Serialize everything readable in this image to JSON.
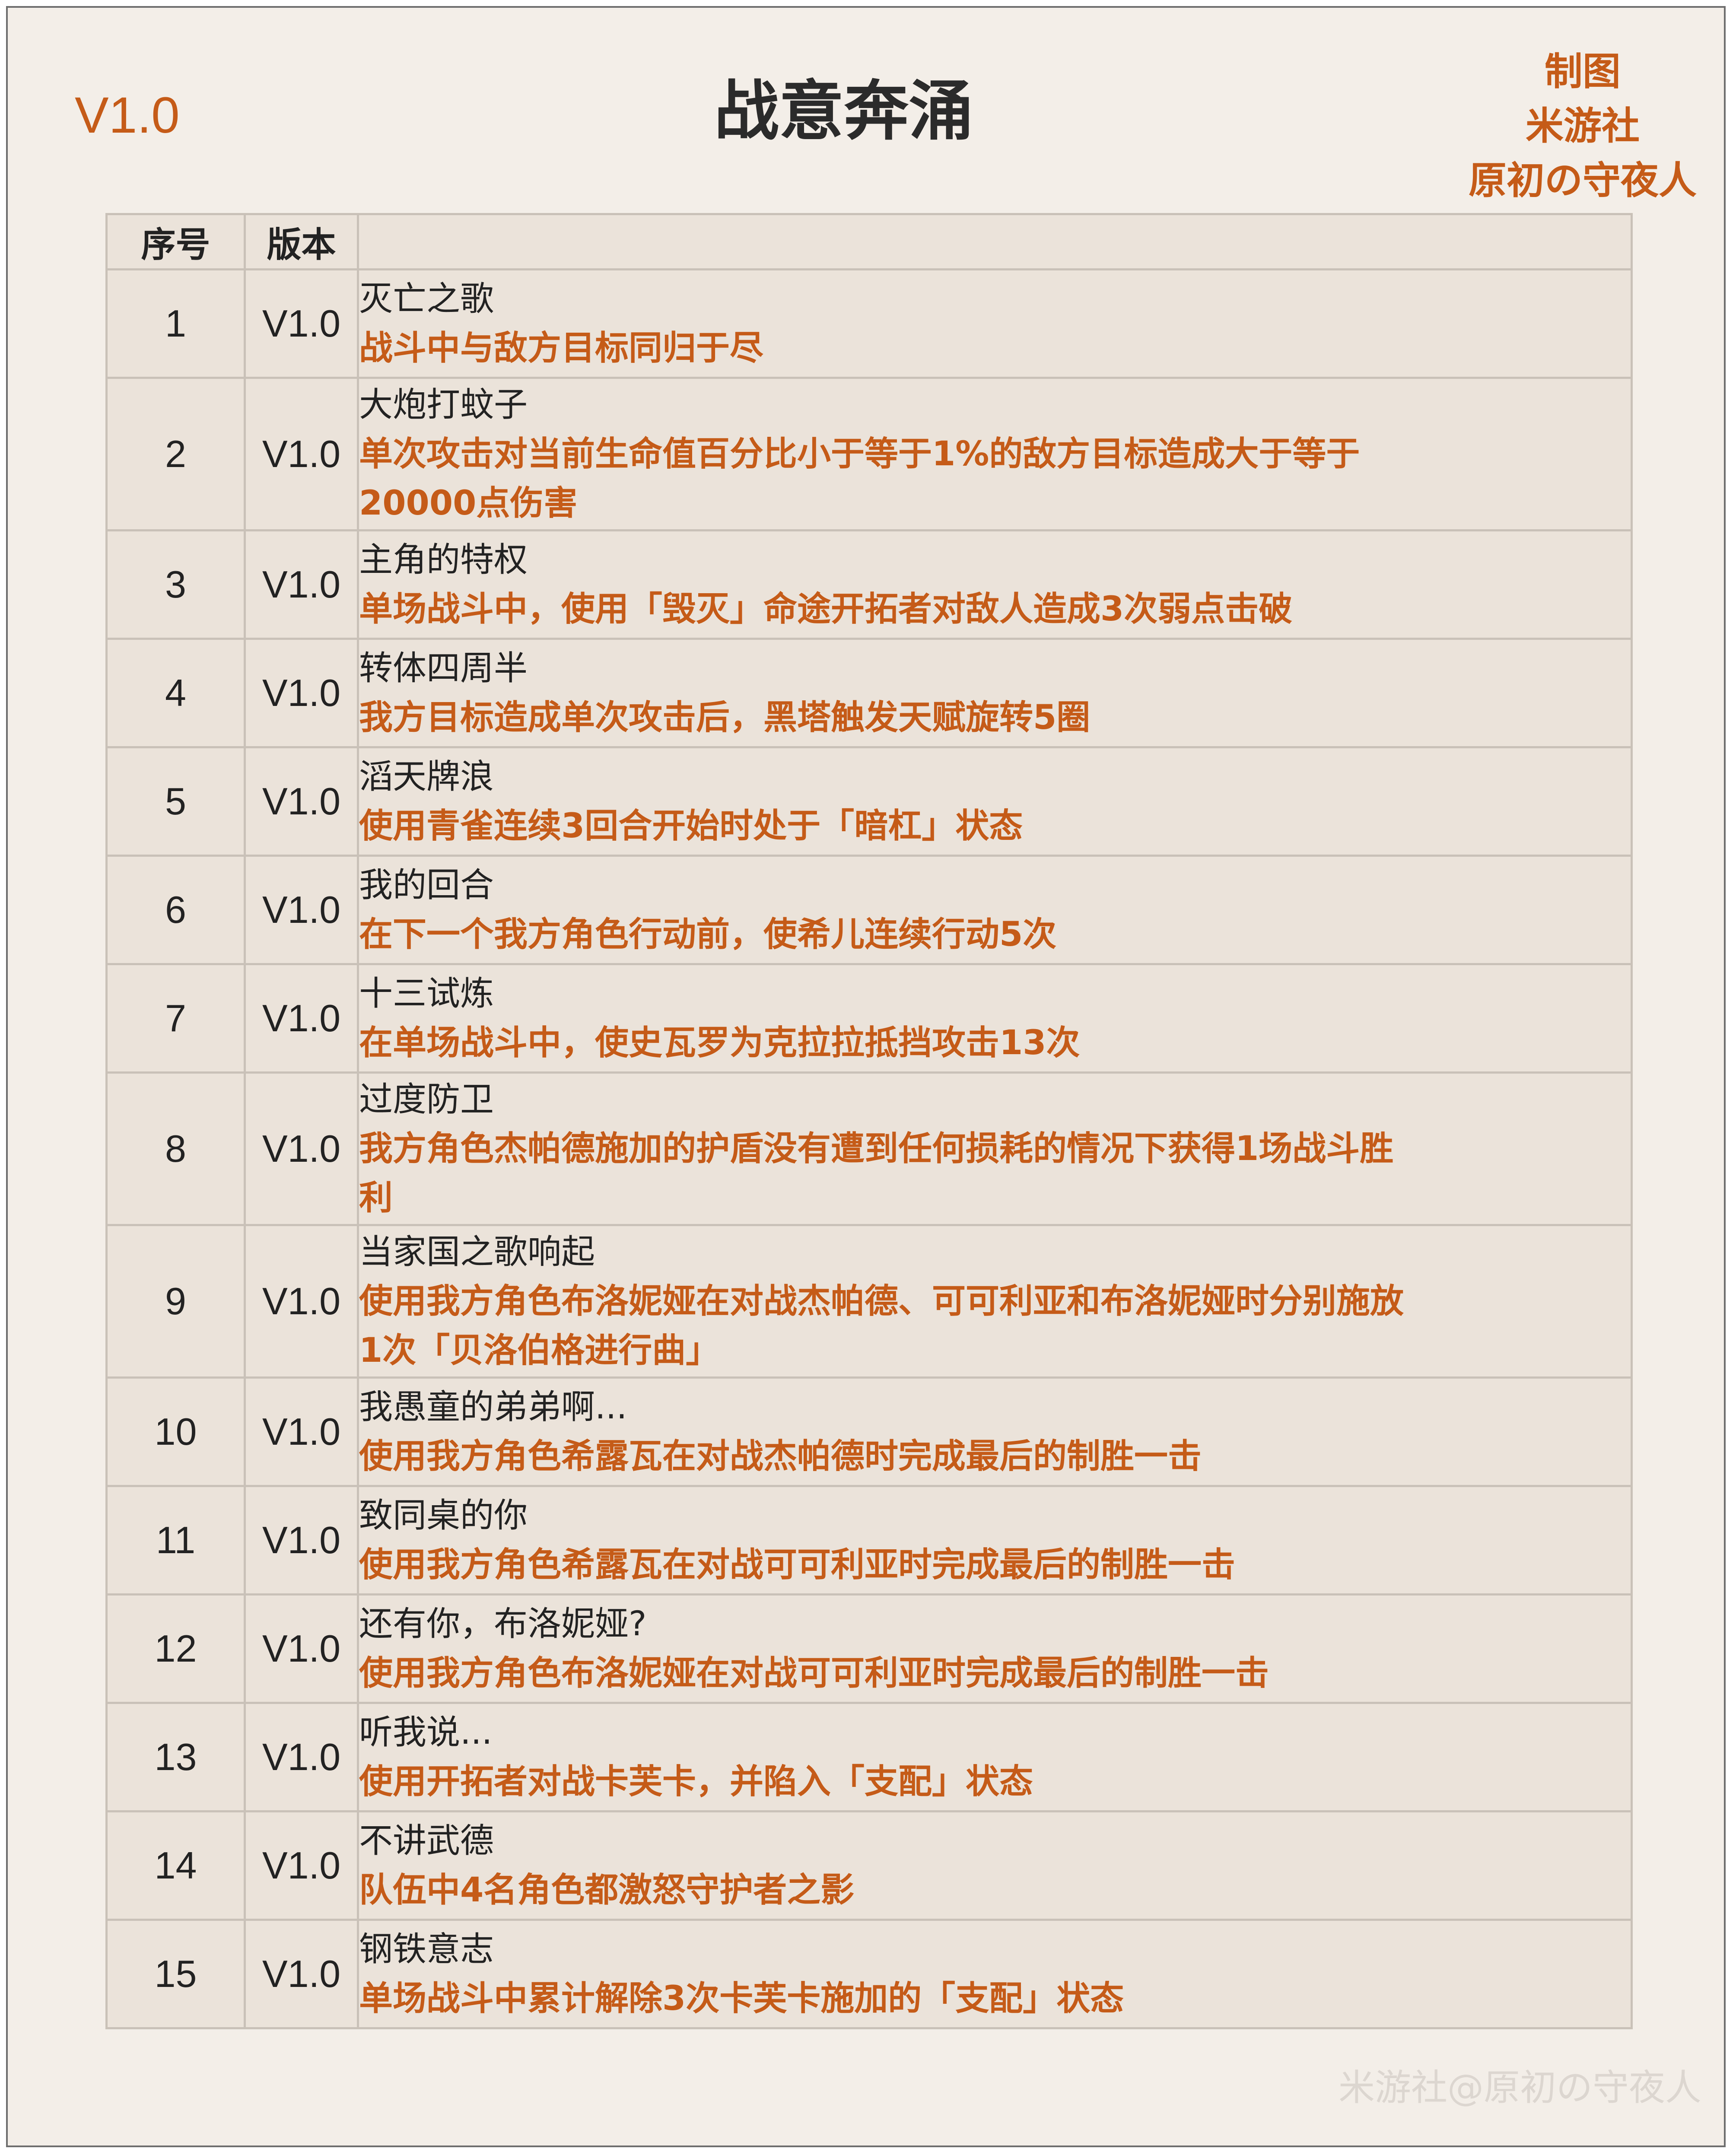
{
  "header": {
    "version_tag": "V1.0",
    "title": "战意奔涌",
    "credit": [
      "制图",
      "米游社",
      "原初の守夜人"
    ]
  },
  "table": {
    "columns": [
      "序号",
      "版本",
      ""
    ],
    "rows": [
      {
        "index": "1",
        "version": "V1.0",
        "name": "灭亡之歌",
        "desc": "战斗中与敌方目标同归于尽"
      },
      {
        "index": "2",
        "version": "V1.0",
        "name": "大炮打蚊子",
        "desc": "单次攻击对当前生命值百分比小于等于1%的敌方目标造成大于等于20000点伤害"
      },
      {
        "index": "3",
        "version": "V1.0",
        "name": "主角的特权",
        "desc": "单场战斗中，使用「毁灭」命途开拓者对敌人造成3次弱点击破"
      },
      {
        "index": "4",
        "version": "V1.0",
        "name": "转体四周半",
        "desc": "我方目标造成单次攻击后，黑塔触发天赋旋转5圈"
      },
      {
        "index": "5",
        "version": "V1.0",
        "name": "滔天牌浪",
        "desc": "使用青雀连续3回合开始时处于「暗杠」状态"
      },
      {
        "index": "6",
        "version": "V1.0",
        "name": "我的回合",
        "desc": "在下一个我方角色行动前，使希儿连续行动5次"
      },
      {
        "index": "7",
        "version": "V1.0",
        "name": "十三试炼",
        "desc": "在单场战斗中，使史瓦罗为克拉拉抵挡攻击13次"
      },
      {
        "index": "8",
        "version": "V1.0",
        "name": "过度防卫",
        "desc": "我方角色杰帕德施加的护盾没有遭到任何损耗的情况下获得1场战斗胜利"
      },
      {
        "index": "9",
        "version": "V1.0",
        "name": "当家国之歌响起",
        "desc": "使用我方角色布洛妮娅在对战杰帕德、可可利亚和布洛妮娅时分别施放1次「贝洛伯格进行曲」"
      },
      {
        "index": "10",
        "version": "V1.0",
        "name": "我愚童的弟弟啊...",
        "desc": "使用我方角色希露瓦在对战杰帕德时完成最后的制胜一击"
      },
      {
        "index": "11",
        "version": "V1.0",
        "name": "致同桌的你",
        "desc": "使用我方角色希露瓦在对战可可利亚时完成最后的制胜一击"
      },
      {
        "index": "12",
        "version": "V1.0",
        "name": "还有你，布洛妮娅?",
        "desc": "使用我方角色布洛妮娅在对战可可利亚时完成最后的制胜一击"
      },
      {
        "index": "13",
        "version": "V1.0",
        "name": "听我说...",
        "desc": "使用开拓者对战卡芙卡，并陷入「支配」状态"
      },
      {
        "index": "14",
        "version": "V1.0",
        "name": "不讲武德",
        "desc": "队伍中4名角色都激怒守护者之影"
      },
      {
        "index": "15",
        "version": "V1.0",
        "name": "钢铁意志",
        "desc": "单场战斗中累计解除3次卡芙卡施加的「支配」状态"
      }
    ]
  },
  "watermark": "米游社@原初の守夜人",
  "colors": {
    "accent": "#c55b18",
    "background": "#f3eee8",
    "cell": "#ebe3da",
    "border": "#c9c1b8",
    "text": "#222222"
  }
}
